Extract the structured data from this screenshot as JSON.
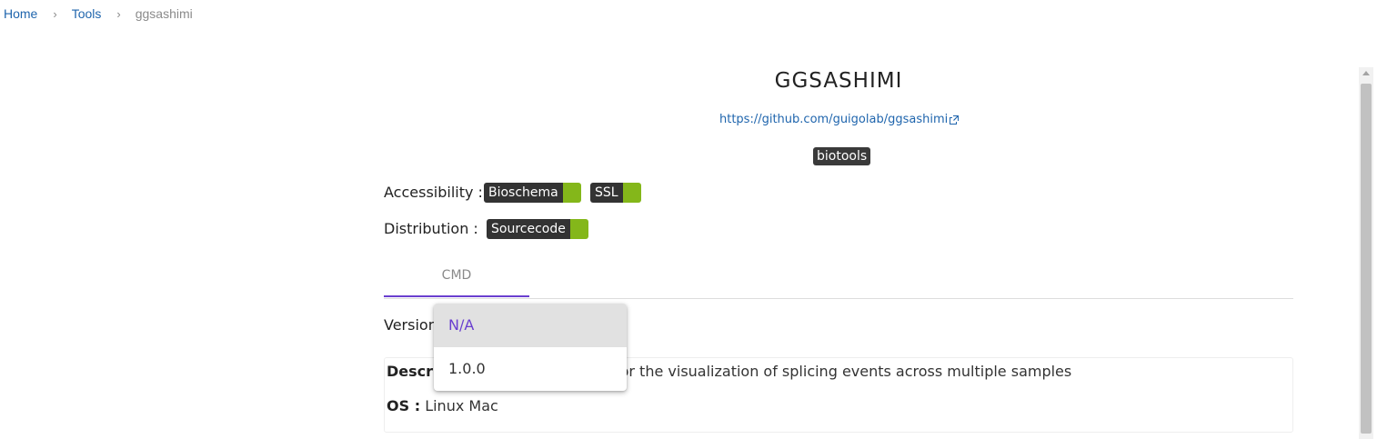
{
  "breadcrumb": {
    "home": "Home",
    "tools": "Tools",
    "current": "ggsashimi",
    "separator": "›"
  },
  "tool": {
    "title": "GGSASHIMI",
    "url": "https://github.com/guigolab/ggsashimi",
    "source_tag": "biotools"
  },
  "accessibility": {
    "label": "Accessibility :",
    "badges": [
      "Bioschema",
      "SSL"
    ]
  },
  "distribution": {
    "label": "Distribution :",
    "badges": [
      "Sourcecode"
    ]
  },
  "tabs": [
    {
      "label": "CMD",
      "active": true
    }
  ],
  "version": {
    "label": "Version",
    "options": [
      "N/A",
      "1.0.0"
    ],
    "selected": "N/A"
  },
  "description": {
    "label": "Descrip",
    "text": "for the visualization of splicing events across multiple samples"
  },
  "os": {
    "label": "OS :",
    "value": "Linux Mac"
  },
  "colors": {
    "accent": "#6a3fcf",
    "link": "#1f65ad",
    "badge_dark": "#333333",
    "badge_ok": "#84b71a"
  },
  "icons": {
    "external_link": "external-link-icon",
    "breadcrumb_separator": "chevron-right-icon"
  }
}
